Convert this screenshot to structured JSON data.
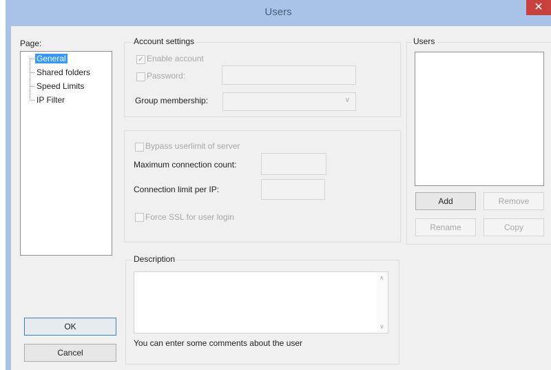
{
  "window": {
    "title": "Users",
    "close_glyph": "✕"
  },
  "page_panel": {
    "label": "Page:",
    "items": [
      {
        "label": "General",
        "selected": true
      },
      {
        "label": "Shared folders",
        "selected": false
      },
      {
        "label": "Speed Limits",
        "selected": false
      },
      {
        "label": "IP Filter",
        "selected": false
      }
    ]
  },
  "account_settings": {
    "legend": "Account settings",
    "enable_account": {
      "label": "Enable account",
      "checked": true,
      "enabled": false
    },
    "password": {
      "label": "Password:",
      "checked": false,
      "enabled": false,
      "value": ""
    },
    "group_membership": {
      "label": "Group membership:",
      "value": ""
    }
  },
  "limits": {
    "bypass_userlimit": {
      "label": "Bypass userlimit of server",
      "checked": false
    },
    "max_connection_count": {
      "label": "Maximum connection count:",
      "value": ""
    },
    "connection_limit_per_ip": {
      "label": "Connection limit per IP:",
      "value": ""
    },
    "force_ssl": {
      "label": "Force SSL for user login",
      "checked": false
    }
  },
  "description": {
    "legend": "Description",
    "value": "",
    "hint": "You can enter some comments about the user"
  },
  "users": {
    "legend": "Users",
    "items": [],
    "add_label": "Add",
    "remove_label": "Remove",
    "rename_label": "Rename",
    "copy_label": "Copy"
  },
  "buttons": {
    "ok_label": "OK",
    "cancel_label": "Cancel"
  },
  "colors": {
    "title_bg": "#a9c3e6",
    "close_bg": "#c8413f",
    "selection": "#3399ff"
  }
}
